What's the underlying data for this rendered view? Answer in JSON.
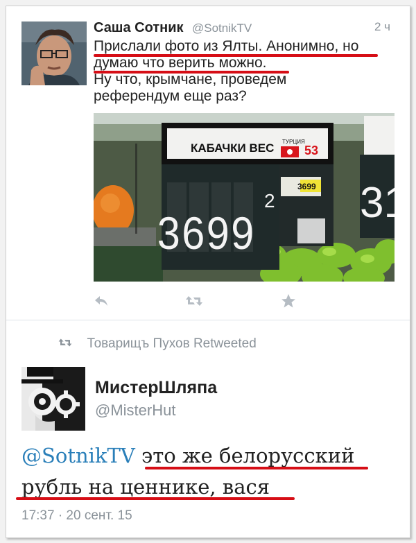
{
  "tweet1": {
    "author_name": "Саша Сотник",
    "author_handle": "@SotnikTV",
    "time": "2 ч",
    "text_lines": [
      "Прислали фото из Ялты. Анонимно, но",
      "думаю что верить можно.",
      "Ну что, крымчане, проведем",
      "референдум еще раз?"
    ],
    "photo": {
      "product_label": "КАБАЧКИ ВЕС",
      "country": "ТУРЦИЯ",
      "store_code": "53",
      "small_price": "3699",
      "price_main": "3699",
      "price_sup": "2",
      "next_price": "31"
    },
    "actions": [
      "reply-icon",
      "retweet-icon",
      "favorite-icon"
    ]
  },
  "retweet_line": {
    "icon": "retweet-icon",
    "text": "Товарищъ Пухов Retweeted"
  },
  "tweet2": {
    "author_name": "МистерШляпа",
    "author_handle": "@MisterHut",
    "mention": "@SotnikTV",
    "text_line1_rest": " это же белорусский",
    "text_line2": "рубль на ценнике, вася",
    "date": "17:37 · 20 сент. 15"
  },
  "colors": {
    "underline": "#d60e16",
    "link": "#2a7fb9",
    "muted": "#8a9299"
  }
}
